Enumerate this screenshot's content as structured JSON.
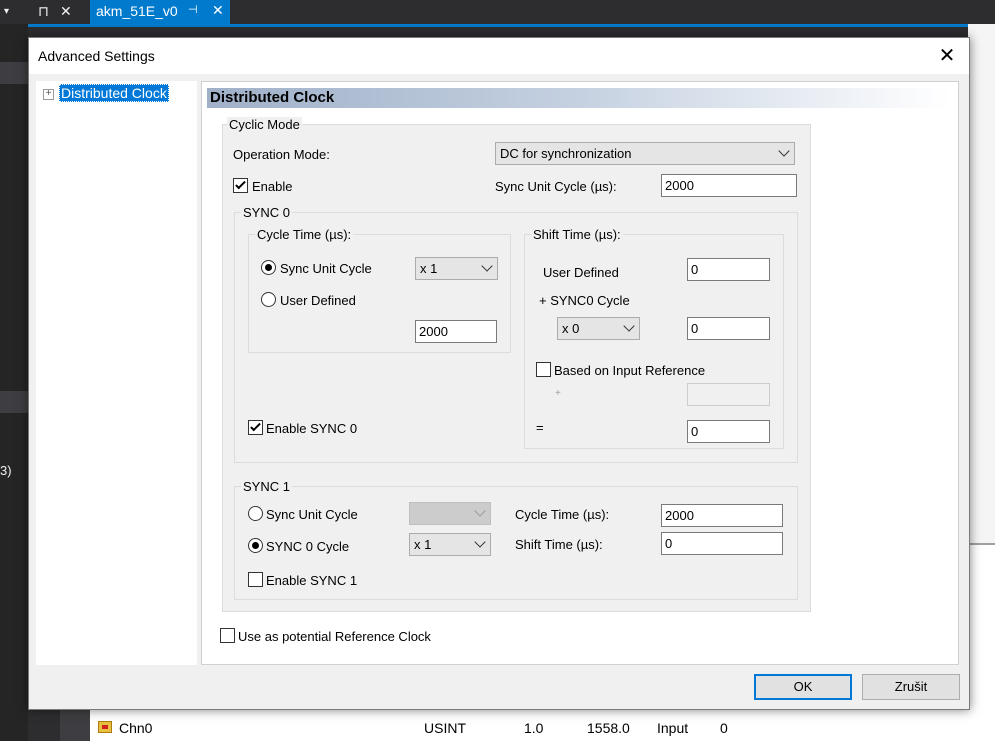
{
  "ide": {
    "doc_tab_title": "akm_51E_v0",
    "top_left_glyphs": [
      "▾",
      "⊓",
      "✕"
    ],
    "left_clipped_text": "3)",
    "bottom_row": {
      "name": "Chn0",
      "type": "USINT",
      "size": "1.0",
      "address": "1558.0",
      "io": "Input",
      "user": "0"
    }
  },
  "dialog": {
    "title": "Advanced Settings",
    "close_glyph": "✕",
    "tree": {
      "expander": "+",
      "item": "Distributed Clock"
    },
    "panel_title": "Distributed Clock",
    "cyclic_mode": {
      "label": "Cyclic Mode",
      "operation_mode_label": "Operation Mode:",
      "operation_mode_value": "DC for synchronization",
      "enable_label": "Enable",
      "enable_checked": true,
      "sync_unit_cycle_label": "Sync Unit Cycle (µs):",
      "sync_unit_cycle_value": "2000"
    },
    "sync0": {
      "label": "SYNC 0",
      "cycle_time": {
        "label": "Cycle Time (µs):",
        "radio_sync_unit_cycle": "Sync Unit Cycle",
        "radio_user_defined": "User Defined",
        "selected": "Sync Unit Cycle",
        "multiplier": "x 1",
        "value": "2000"
      },
      "shift_time": {
        "label": "Shift Time (µs):",
        "user_defined_label": "User Defined",
        "user_defined_value": "0",
        "plus_sync0_cycle_label": "+ SYNC0 Cycle",
        "multiplier": "x 0",
        "multiplier_value": "0",
        "based_on_input_label": "Based on Input Reference",
        "based_on_input_checked": false,
        "plus_sign": "+",
        "input_reference_value": "",
        "equals_sign": "=",
        "result_value": "0"
      },
      "enable_label": "Enable SYNC 0",
      "enable_checked": true
    },
    "sync1": {
      "label": "SYNC 1",
      "radio_sync_unit_cycle": "Sync Unit Cycle",
      "radio_sync0_cycle": "SYNC 0 Cycle",
      "selected": "SYNC 0 Cycle",
      "sync_unit_multiplier": "",
      "sync0_multiplier": "x 1",
      "cycle_time_label": "Cycle Time (µs):",
      "cycle_time_value": "2000",
      "shift_time_label": "Shift Time (µs):",
      "shift_time_value": "0",
      "enable_label": "Enable SYNC 1",
      "enable_checked": false
    },
    "reference_clock_label": "Use as potential Reference Clock",
    "reference_clock_checked": false,
    "ok_label": "OK",
    "cancel_label": "Zrušit"
  }
}
